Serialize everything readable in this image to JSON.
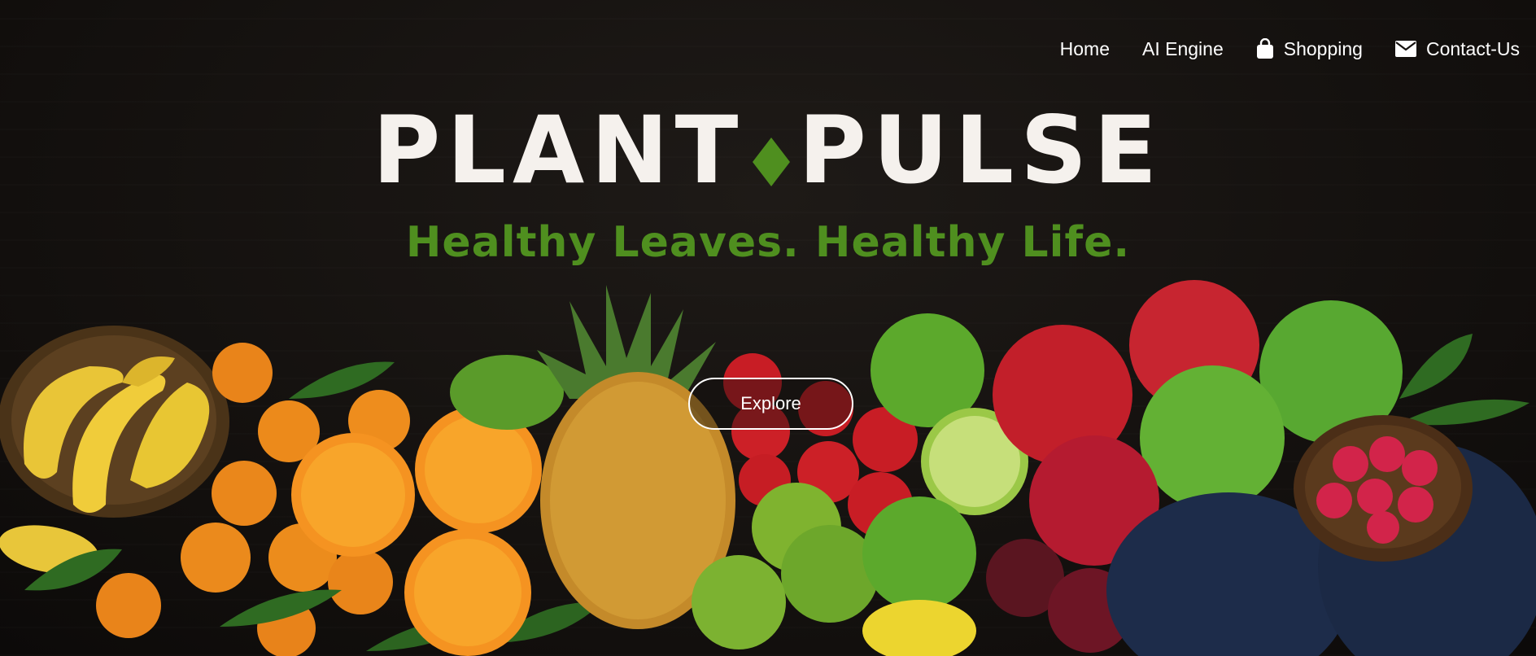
{
  "nav": {
    "items": [
      {
        "label": "Home",
        "icon": ""
      },
      {
        "label": "AI Engine",
        "icon": ""
      },
      {
        "label": "Shopping",
        "icon": "shopping-bag-icon"
      },
      {
        "label": "Contact-Us",
        "icon": "envelope-icon"
      }
    ]
  },
  "hero": {
    "brand_left": "PLANT",
    "brand_right": "PULSE",
    "tagline": "Healthy Leaves. Healthy Life.",
    "button_label": "Explore",
    "colors": {
      "background": "#151210",
      "brand_text": "#f5f1ed",
      "accent_green": "#4f8f1f",
      "button_border": "#ffffff"
    }
  }
}
